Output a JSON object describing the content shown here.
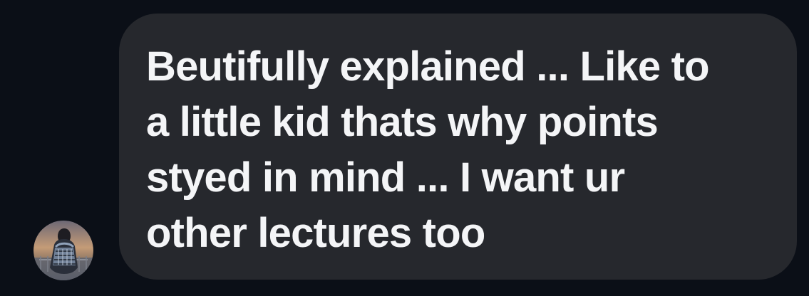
{
  "conversation": {
    "message": {
      "text": "Beutifully explained ... Like to\na little kid thats why points\nstyed in mind ... I want ur\nother lectures too"
    },
    "sender": {
      "avatar_icon": "profile-photo-icon"
    }
  },
  "colors": {
    "background": "#0b0f17",
    "bubble": "#26282d",
    "text": "#f4f5f7"
  }
}
